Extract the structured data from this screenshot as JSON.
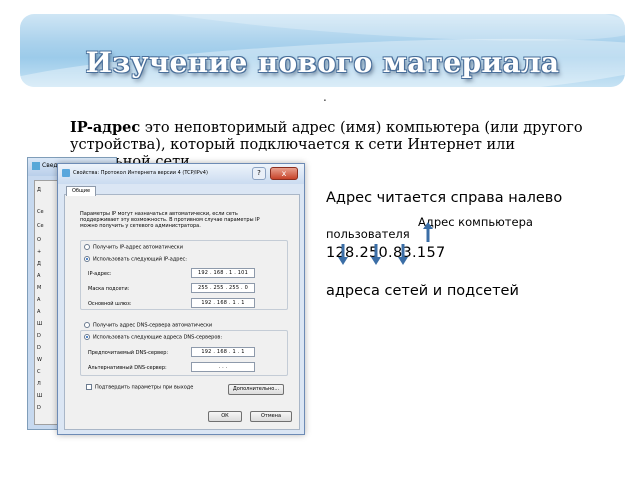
{
  "slide": {
    "title": "Изучение нового материала",
    "dot": ".",
    "intro_term": "IP-адрес",
    "intro_text": " это неповторимый адрес (имя) компьютера (или другого устройства), который подключается к сети Интернет или локальной сети."
  },
  "dialog": {
    "back_window_title": "Свед",
    "title": "Свойства: Протокол Интернета версии 4 (TCP/IPv4)",
    "help_button": "?",
    "close_button": "x",
    "tab_general": "Общие",
    "description": "Параметры IP могут назначаться автоматически, если сеть поддерживает эту возможность. В противном случае параметры IP можно получить у сетевого администратора.",
    "radio_auto_ip": "Получить IP-адрес автоматически",
    "radio_manual_ip": "Использовать следующий IP-адрес:",
    "label_ip": "IP-адрес:",
    "value_ip": "192 . 168 .  1  . 101",
    "label_mask": "Маска подсети:",
    "value_mask": "255 . 255 . 255 .  0",
    "label_gateway": "Основной шлюз:",
    "value_gateway": "192 . 168 .  1  .  1",
    "radio_auto_dns": "Получить адрес DNS-сервера автоматически",
    "radio_manual_dns": "Использовать следующие адреса DNS-серверов:",
    "label_dns1": "Предпочитаемый DNS-сервер:",
    "value_dns1": "192 . 168 .  1  .  1",
    "label_dns2": "Альтернативный DNS-сервер:",
    "value_dns2": "   .     .     .   ",
    "checkbox_validate": "Подтвердить параметры при выходе",
    "button_advanced": "Дополнительно...",
    "button_ok": "ОК",
    "button_cancel": "Отмена",
    "back_glyphs": [
      "Д",
      "Се",
      "Се",
      "О",
      "+",
      "Д",
      "A",
      "M",
      "A",
      "A",
      "Ш",
      "D",
      "D",
      "W",
      "C",
      "Л",
      "Ш",
      "D"
    ]
  },
  "notes": {
    "reading": "Адрес читается справа налево",
    "user_addr_1": "Адрес компьютера",
    "user_addr_2": "пользователя",
    "ip_example": "128.250.83.157",
    "networks": "адреса сетей и подсетей"
  },
  "colors": {
    "arrow": "#3b6ea6"
  }
}
